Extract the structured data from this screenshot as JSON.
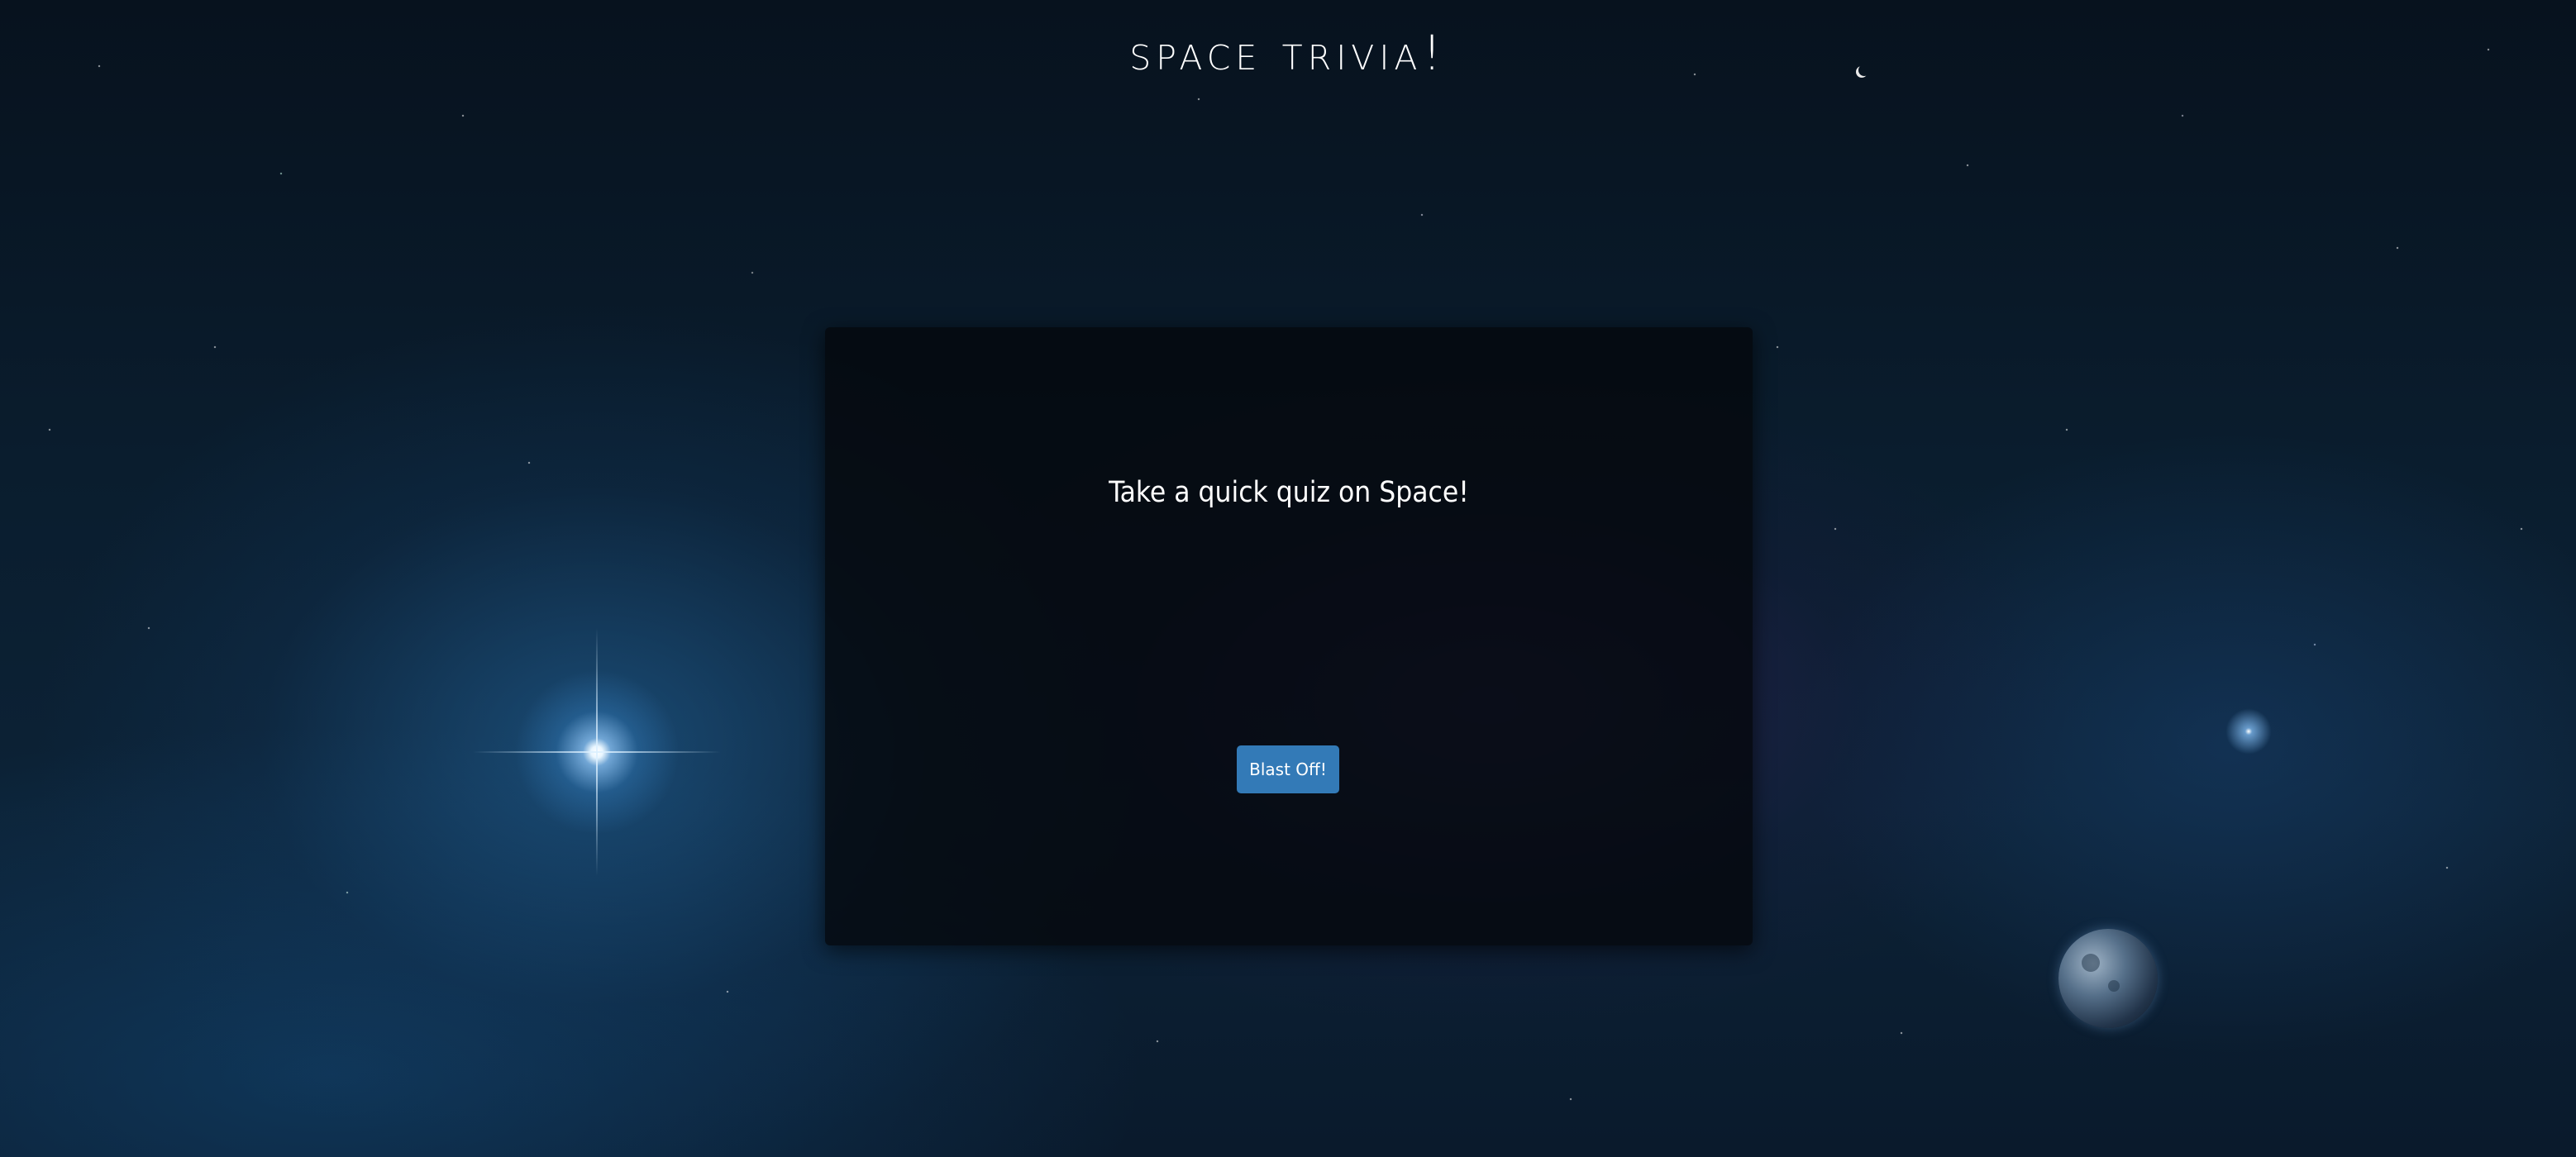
{
  "header": {
    "title": "Space Trivia!"
  },
  "quiz": {
    "intro": "Take a quick quiz on Space!",
    "start_label": "Blast Off!"
  },
  "colors": {
    "button": "#337ab7",
    "card_background": "#05080e",
    "page_background": "#0a1d2e",
    "text": "#ffffff"
  }
}
